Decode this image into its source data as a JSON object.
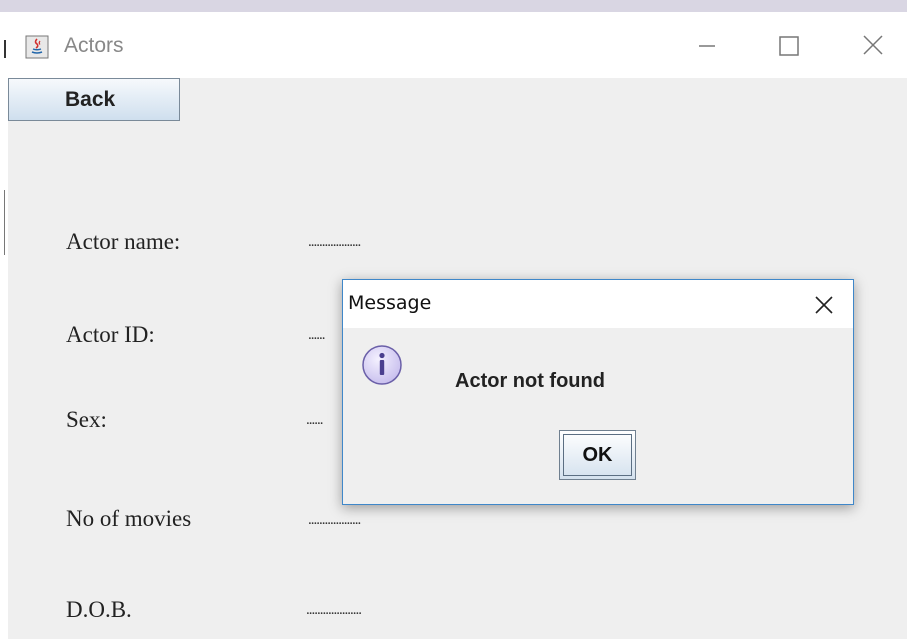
{
  "window": {
    "title": "Actors",
    "controls": [
      "minimize",
      "maximize",
      "close"
    ]
  },
  "toolbar": {
    "back_label": "Back"
  },
  "fields": [
    {
      "label": "Actor name:",
      "value": "..................."
    },
    {
      "label": "Actor ID:",
      "value": "......"
    },
    {
      "label": "Sex:",
      "value": "......"
    },
    {
      "label": "No of movies",
      "value": "..................."
    },
    {
      "label": "D.O.B.",
      "value": "...................."
    }
  ],
  "dialog": {
    "title": "Message",
    "icon": "info-icon",
    "message": "Actor not found",
    "ok_label": "OK"
  },
  "colors": {
    "window_bg": "#efefef",
    "dialog_border": "#3f87c9",
    "button_gradient_top": "#f6f9fc",
    "button_gradient_bottom": "#cfdfee",
    "info_icon_fill": "#d8d2f2"
  }
}
